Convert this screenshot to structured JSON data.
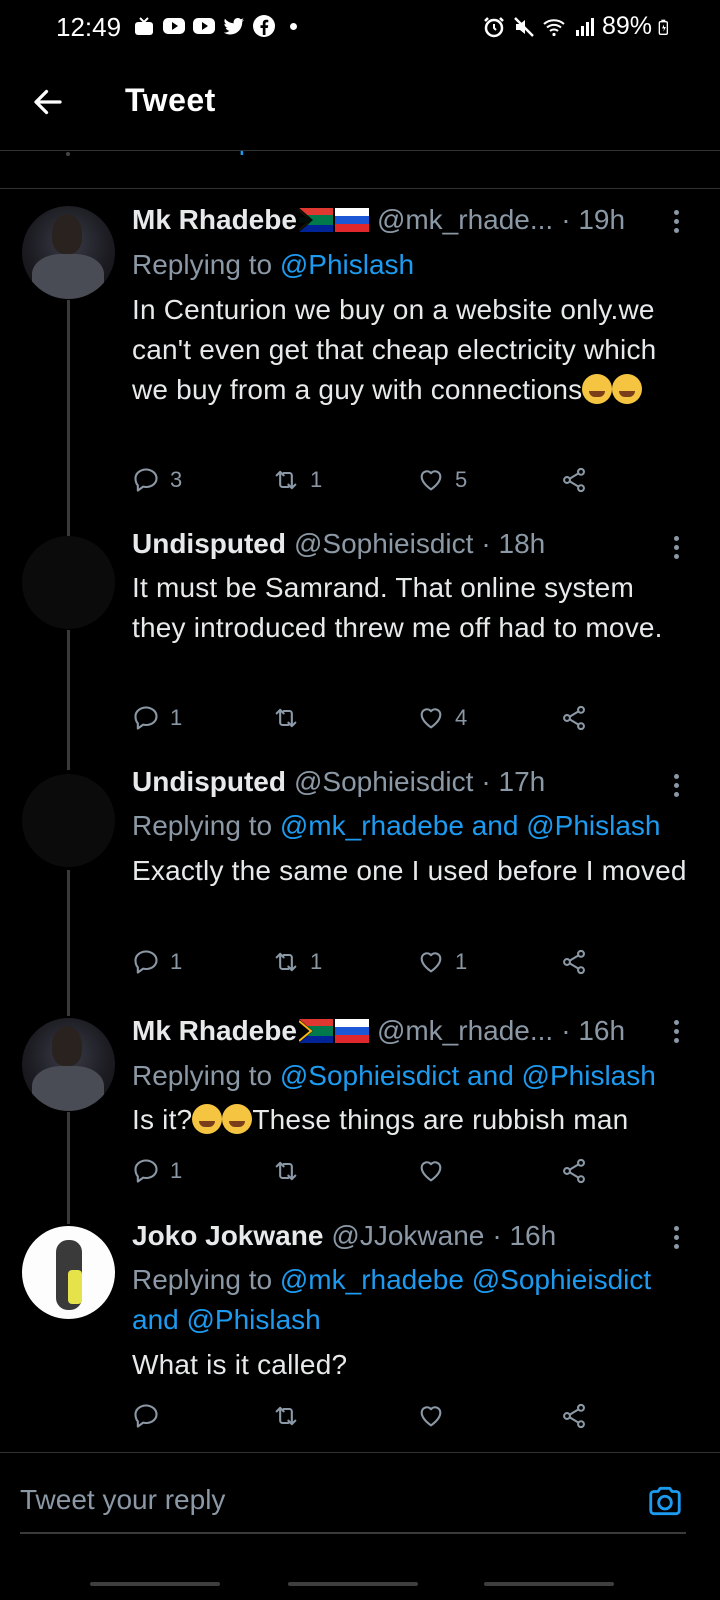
{
  "status_bar": {
    "time": "12:49",
    "battery": "89%",
    "left_icons": [
      "notification-icon",
      "youtube-icon",
      "youtube-icon",
      "twitter-icon",
      "facebook-icon"
    ],
    "right_icons": [
      "alarm-icon",
      "mute-icon",
      "wifi-icon",
      "signal-icon",
      "battery-icon"
    ]
  },
  "header": {
    "title": "Tweet"
  },
  "show_replies": "Show replies",
  "tweets": [
    {
      "name": "Mk Rhadebe",
      "flags": [
        "south-africa-flag",
        "russia-flag"
      ],
      "handle": "@mk_rhade...",
      "time": "· 19h",
      "replying_prefix": "Replying to",
      "replying_to": "@Phislash",
      "body": "In Centurion we buy on a website only.we can't even get that cheap electricity which we buy from a guy with connections",
      "emojis": [
        "crying-face-emoji",
        "crying-face-emoji"
      ],
      "replies": "3",
      "retweets": "1",
      "likes": "5"
    },
    {
      "name": "Undisputed",
      "handle": "@Sophieisdict",
      "time": "· 18h",
      "body": "It must be Samrand. That online system they introduced threw me off had to move.",
      "replies": "1",
      "retweets": "",
      "likes": "4"
    },
    {
      "name": "Undisputed",
      "handle": "@Sophieisdict",
      "time": "· 17h",
      "replying_prefix": "Replying to",
      "replying_to": "@mk_rhadebe and @Phislash",
      "body": "Exactly the same one I used before I moved",
      "replies": "1",
      "retweets": "1",
      "likes": "1"
    },
    {
      "name": "Mk Rhadebe",
      "flags": [
        "south-africa-flag",
        "russia-flag"
      ],
      "handle": "@mk_rhade...",
      "time": "· 16h",
      "replying_prefix": "Replying to",
      "replying_to": "@Sophieisdict and @Phislash",
      "body_prefix": "Is it?",
      "emojis": [
        "tears-of-joy-emoji",
        "rofl-emoji"
      ],
      "body_suffix": "These things are rubbish man",
      "replies": "1",
      "retweets": "",
      "likes": ""
    },
    {
      "name": "Joko Jokwane",
      "handle": "@JJokwane",
      "time": "· 16h",
      "replying_prefix": "Replying to",
      "replying_to": "@mk_rhadebe @Sophieisdict and @Phislash",
      "body": "What is it called?",
      "replies": "",
      "retweets": "",
      "likes": ""
    }
  ],
  "reply_bar": {
    "placeholder": "Tweet your reply"
  },
  "colors": {
    "background": "#000000",
    "accent": "#1d9bf0",
    "secondary_text": "#8b98a5",
    "primary_text": "#e7e9ea"
  }
}
